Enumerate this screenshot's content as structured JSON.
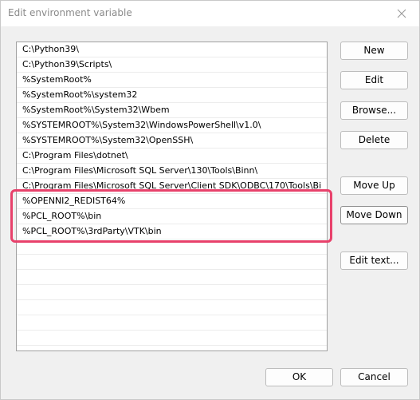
{
  "window": {
    "title": "Edit environment variable"
  },
  "list": {
    "items": [
      "C:\\Python39\\",
      "C:\\Python39\\Scripts\\",
      "%SystemRoot%",
      "%SystemRoot%\\system32",
      "%SystemRoot%\\System32\\Wbem",
      "%SYSTEMROOT%\\System32\\WindowsPowerShell\\v1.0\\",
      "%SYSTEMROOT%\\System32\\OpenSSH\\",
      "C:\\Program Files\\dotnet\\",
      "C:\\Program Files\\Microsoft SQL Server\\130\\Tools\\Binn\\",
      "C:\\Program Files\\Microsoft SQL Server\\Client SDK\\ODBC\\170\\Tools\\Bi",
      "%OPENNI2_REDIST64%",
      "%PCL_ROOT%\\bin",
      "%PCL_ROOT%\\3rdParty\\VTK\\bin",
      "",
      "",
      "",
      "",
      "",
      "",
      "",
      ""
    ]
  },
  "buttons": {
    "new": "New",
    "edit": "Edit",
    "browse": "Browse...",
    "delete": "Delete",
    "move_up": "Move Up",
    "move_down": "Move Down",
    "edit_text": "Edit text...",
    "ok": "OK",
    "cancel": "Cancel"
  },
  "colors": {
    "highlight": "#e8416b"
  }
}
